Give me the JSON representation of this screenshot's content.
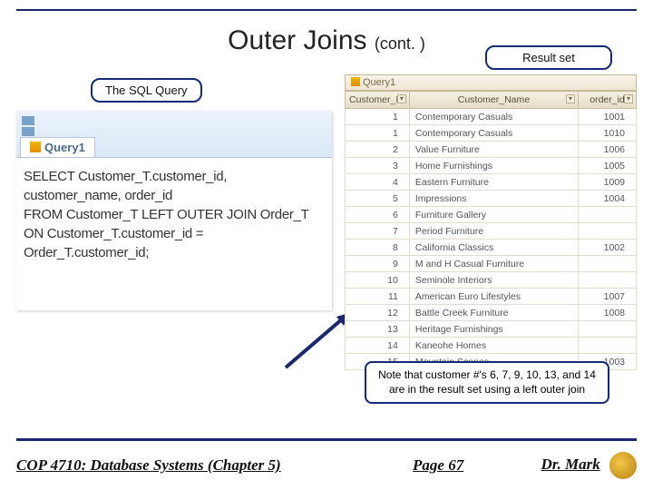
{
  "title_main": "Outer Joins ",
  "title_cont": "(cont. )",
  "labels": {
    "sql": "The SQL Query",
    "result": "Result set"
  },
  "sql": {
    "tab": "Query1",
    "line1": "SELECT Customer_T.customer_id, customer_name, order_id",
    "line2": "FROM Customer_T LEFT OUTER JOIN Order_T",
    "line3": "ON Customer_T.customer_id = Order_T.customer_id;"
  },
  "result": {
    "tab": "Query1",
    "headers": {
      "id": "Customer_ID",
      "name": "Customer_Name",
      "order": "order_id"
    },
    "rows": [
      {
        "id": "1",
        "name": "Contemporary Casuals",
        "order": "1001"
      },
      {
        "id": "1",
        "name": "Contemporary Casuals",
        "order": "1010"
      },
      {
        "id": "2",
        "name": "Value Furniture",
        "order": "1006"
      },
      {
        "id": "3",
        "name": "Home Furnishings",
        "order": "1005"
      },
      {
        "id": "4",
        "name": "Eastern Furniture",
        "order": "1009"
      },
      {
        "id": "5",
        "name": "Impressions",
        "order": "1004"
      },
      {
        "id": "6",
        "name": "Furniture Gallery",
        "order": ""
      },
      {
        "id": "7",
        "name": "Period Furniture",
        "order": ""
      },
      {
        "id": "8",
        "name": "California Classics",
        "order": "1002"
      },
      {
        "id": "9",
        "name": "M and H Casual Furniture",
        "order": ""
      },
      {
        "id": "10",
        "name": "Seminole Interiors",
        "order": ""
      },
      {
        "id": "11",
        "name": "American Euro Lifestyles",
        "order": "1007"
      },
      {
        "id": "12",
        "name": "Battle Creek Furniture",
        "order": "1008"
      },
      {
        "id": "13",
        "name": "Heritage Furnishings",
        "order": ""
      },
      {
        "id": "14",
        "name": "Kaneohe Homes",
        "order": ""
      },
      {
        "id": "15",
        "name": "Mountain Scenes",
        "order": "1003"
      }
    ]
  },
  "note": "Note that customer #'s 6, 7, 9, 10, 13, and 14 are in the result set using a left outer join",
  "footer": {
    "course": "COP 4710: Database Systems  (Chapter 5)",
    "page": "Page 67",
    "author": "Dr. Mark"
  }
}
